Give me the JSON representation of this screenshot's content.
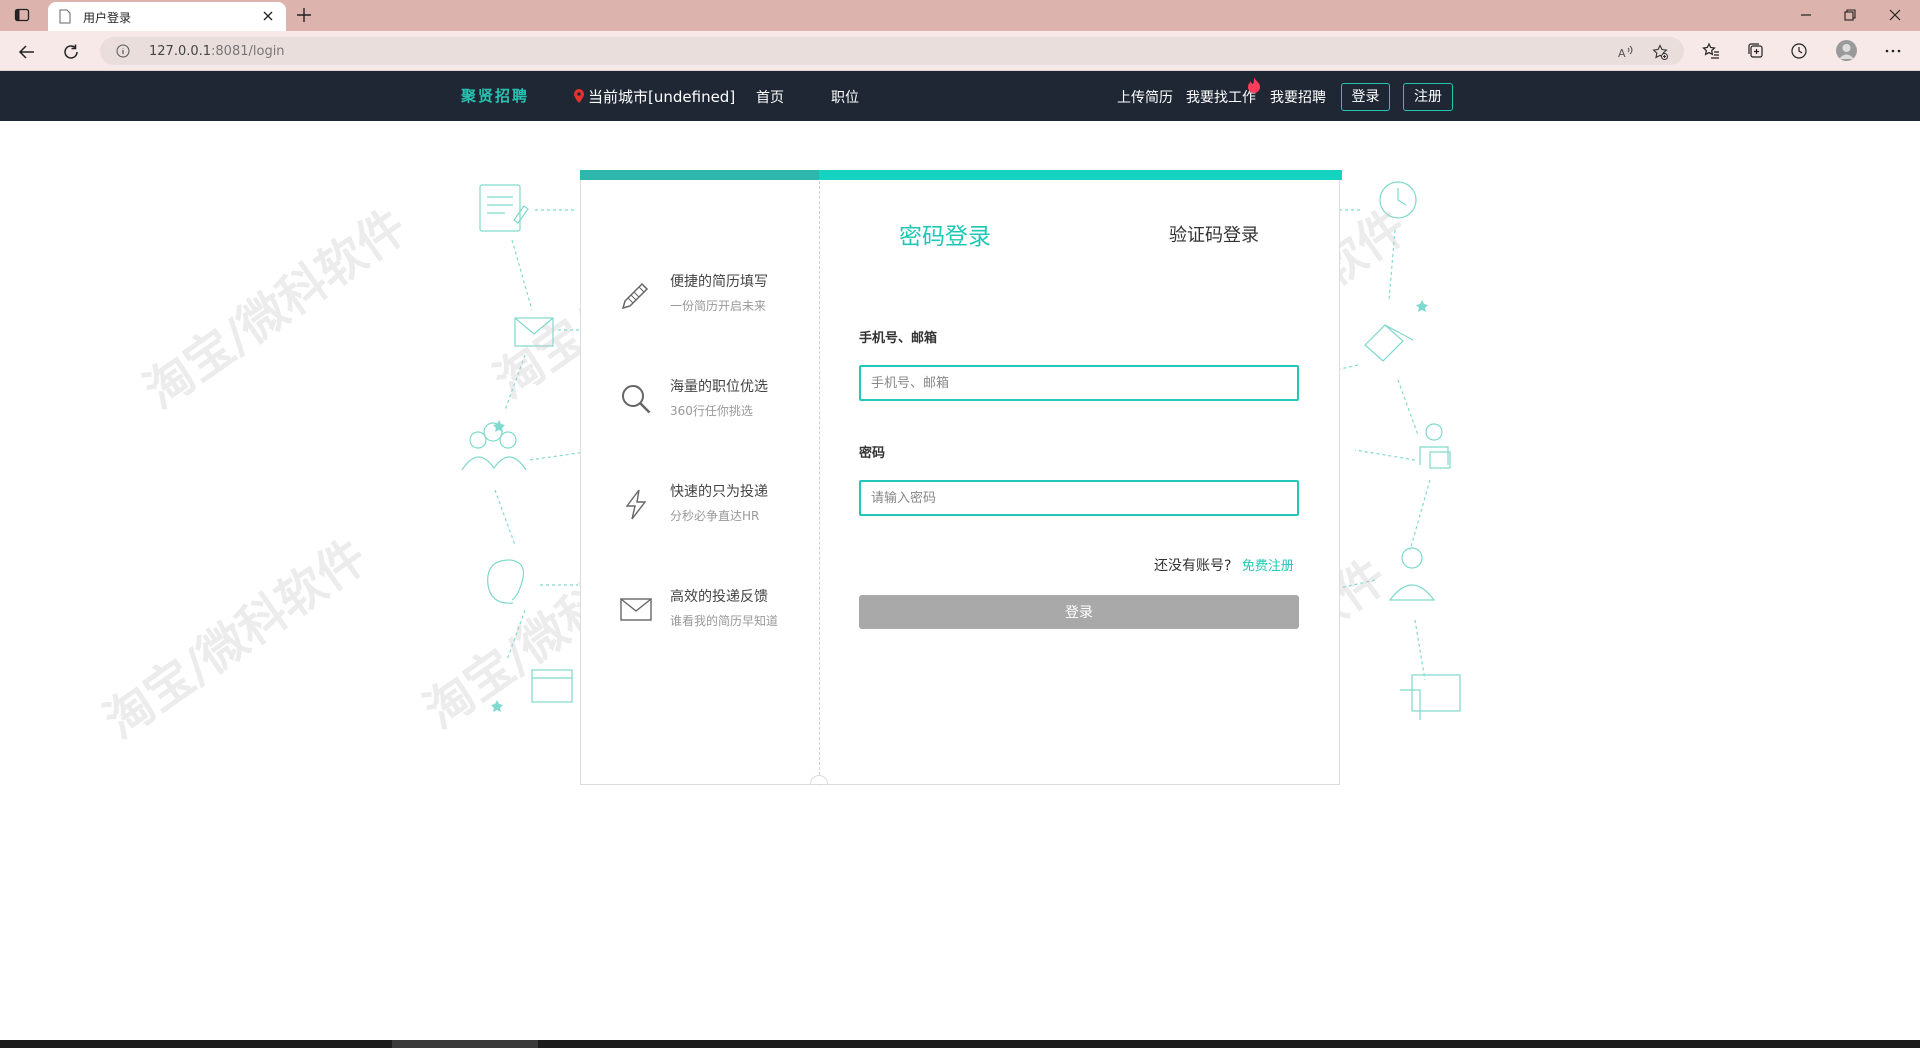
{
  "browser": {
    "tab_title": "用户登录",
    "url_host": "127.0.0.1",
    "url_rest": ":8081/login"
  },
  "header": {
    "logo": "聚贤招聘",
    "city": "当前城市[undefined]",
    "nav": [
      "首页",
      "职位"
    ],
    "links": [
      "上传简历",
      "我要找工作",
      "我要招聘"
    ],
    "login_button": "登录",
    "register_button": "注册"
  },
  "features": [
    {
      "title": "便捷的简历填写",
      "subtitle": "一份简历开启未来",
      "icon": "pencil-icon"
    },
    {
      "title": "海量的职位优选",
      "subtitle": "360行任你挑选",
      "icon": "magnifier-icon"
    },
    {
      "title": "快速的只为投递",
      "subtitle": "分秒必争直达HR",
      "icon": "lightning-icon"
    },
    {
      "title": "高效的投递反馈",
      "subtitle": "谁看我的简历早知道",
      "icon": "envelope-icon"
    }
  ],
  "login": {
    "tab_password": "密码登录",
    "tab_code": "验证码登录",
    "account_label": "手机号、邮箱",
    "account_placeholder": "手机号、邮箱",
    "password_label": "密码",
    "password_placeholder": "请输入密码",
    "no_account": "还没有账号?",
    "register_link": "免费注册",
    "submit": "登录"
  },
  "watermark": "淘宝/微科软件",
  "colors": {
    "accent": "#1fc8b6",
    "header_bg": "#1f2735",
    "submit_disabled": "#a9a9a9"
  }
}
